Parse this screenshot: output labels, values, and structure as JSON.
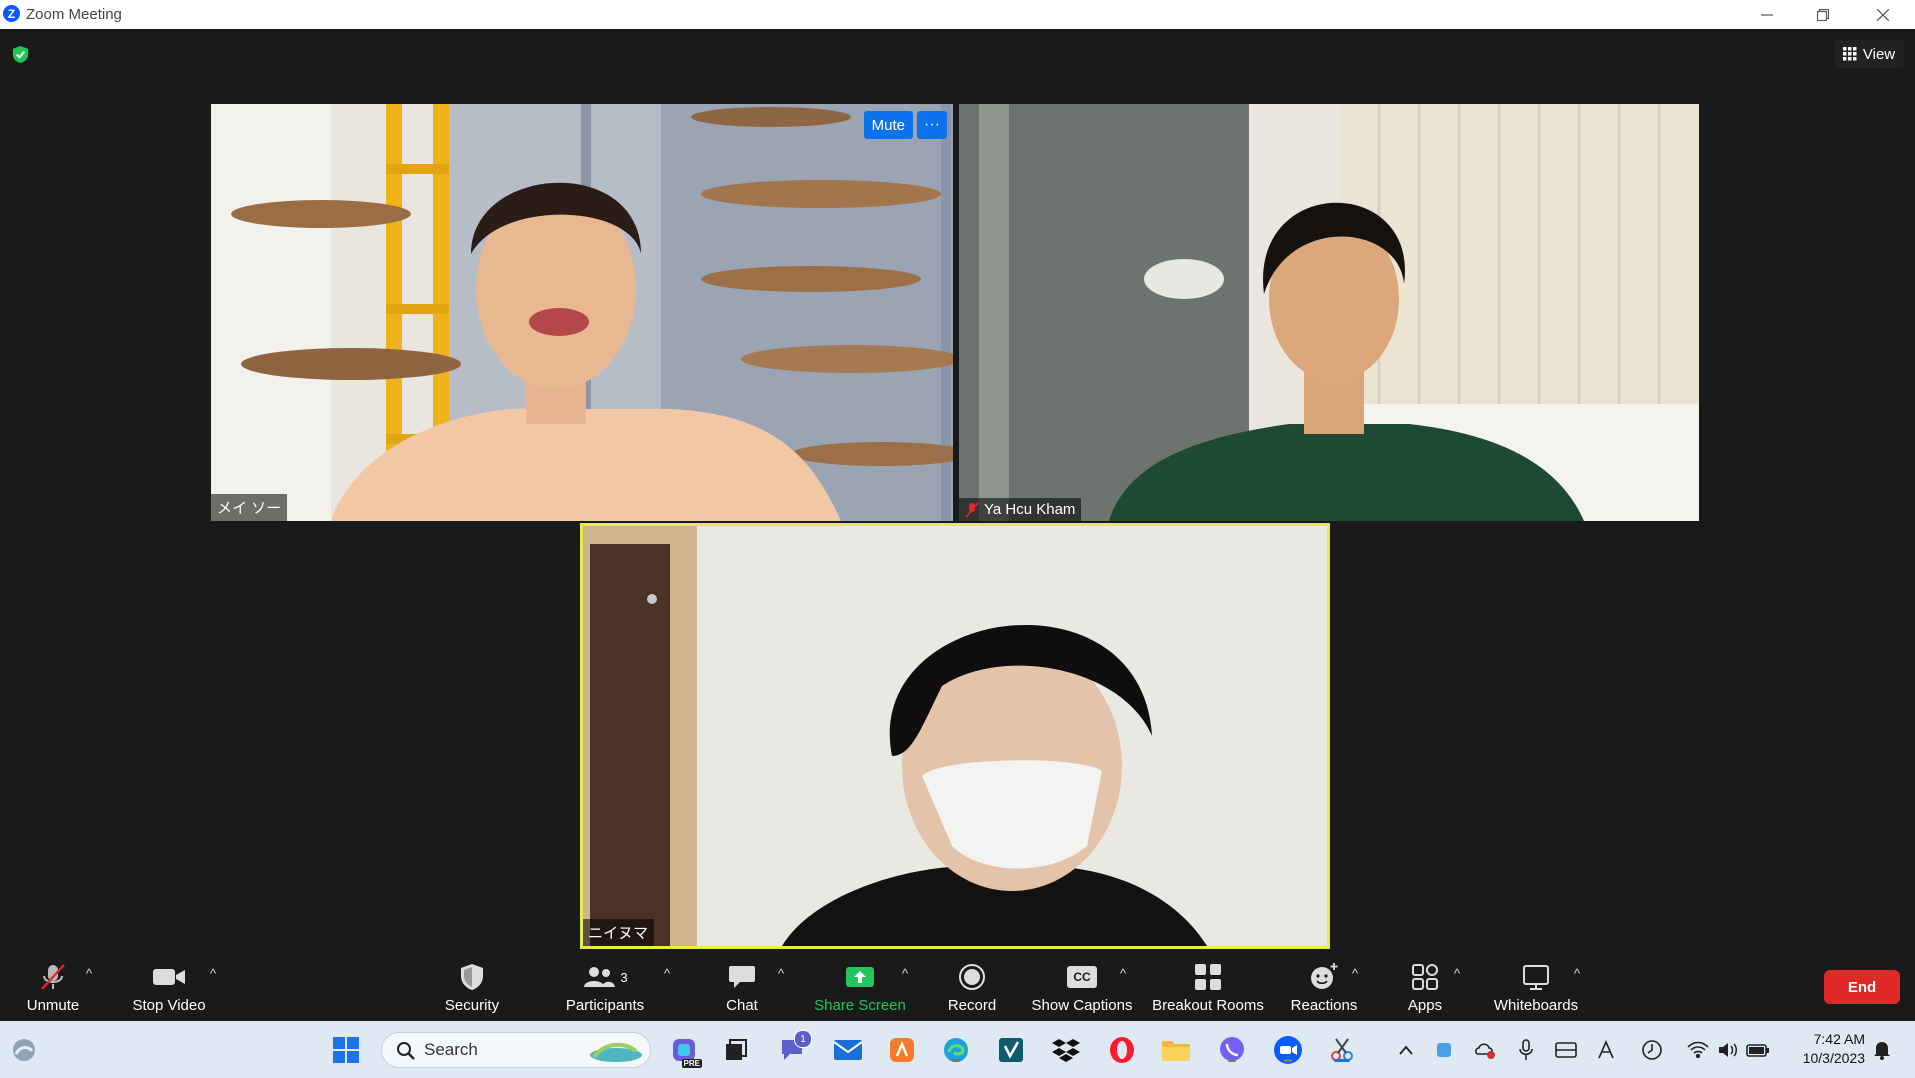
{
  "window": {
    "title": "Zoom Meeting"
  },
  "header": {
    "view_label": "View"
  },
  "participants": [
    {
      "name": "メイ ソー",
      "muted": false,
      "tile_buttons": {
        "mute": "Mute",
        "more": "···"
      }
    },
    {
      "name": "Ya Hcu Kham",
      "muted": true
    },
    {
      "name": "ニイヌマ",
      "muted": false,
      "active_speaker": true
    }
  ],
  "toolbar": {
    "unmute": "Unmute",
    "stop_video": "Stop Video",
    "security": "Security",
    "participants": "Participants",
    "participants_count": "3",
    "chat": "Chat",
    "share_screen": "Share Screen",
    "record": "Record",
    "show_captions": "Show Captions",
    "captions_badge": "CC",
    "breakout_rooms": "Breakout Rooms",
    "reactions": "Reactions",
    "apps": "Apps",
    "whiteboards": "Whiteboards",
    "end": "End",
    "caret": "^"
  },
  "taskbar": {
    "search_label": "Search",
    "time": "7:42 AM",
    "date": "10/3/2023",
    "pinned": [
      "widgets-icon",
      "start-icon",
      "copilot-icon",
      "task-view-icon",
      "teams-chat-icon",
      "mail-icon",
      "office-icon",
      "edge-icon",
      "smartsheet-icon",
      "dropbox-icon",
      "opera-icon",
      "file-explorer-icon",
      "viber-icon",
      "zoom-icon",
      "snipping-tool-icon"
    ],
    "teams_badge": "1",
    "office_badge": "PRE"
  },
  "colors": {
    "active_speaker_border": "#e6ea4b",
    "end_button": "#e02828",
    "share_green": "#22c55e",
    "accent_blue": "#0e72ed"
  }
}
